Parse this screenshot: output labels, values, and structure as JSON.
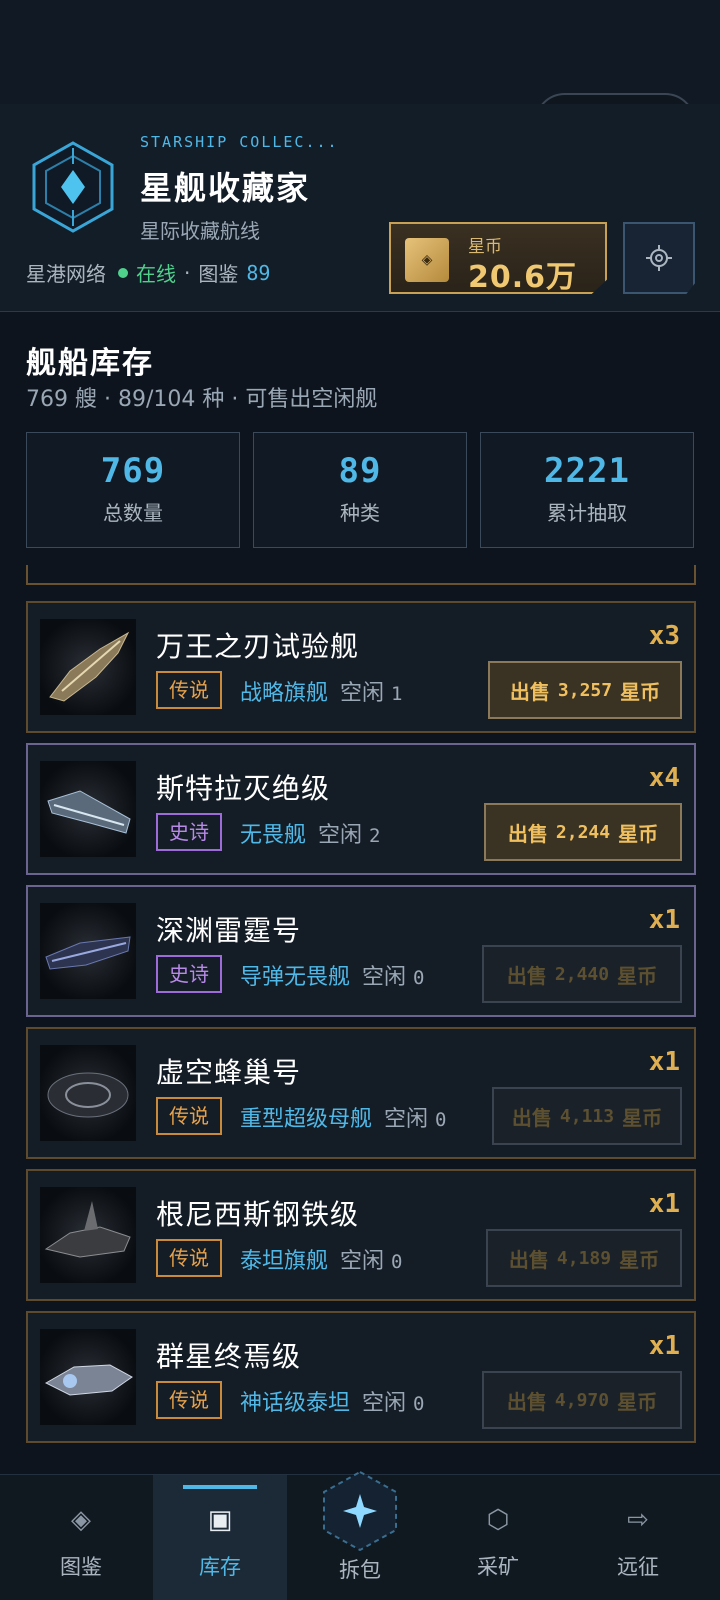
{
  "header": {
    "subtitle_en": "STARSHIP COLLEC...",
    "app_title": "星舰收藏家",
    "app_subtitle": "星际收藏航线",
    "network_label": "星港网络",
    "status_online": "在线",
    "separator": "·",
    "codex_label": "图鉴",
    "codex_count": "89",
    "currency_label": "星币",
    "currency_value": "20.6万",
    "capsule_dots": "•••"
  },
  "inventory": {
    "title": "舰船库存",
    "summary": "769 艘 · 89/104 种 · 可售出空闲舰",
    "stats": [
      {
        "value": "769",
        "label": "总数量"
      },
      {
        "value": "89",
        "label": "种类"
      },
      {
        "value": "2221",
        "label": "累计抽取"
      }
    ],
    "idle_label": "空闲",
    "sell_label": "出售",
    "coin_unit": "星币",
    "ships": [
      {
        "name": "万王之刃试验舰",
        "rarity": "传说",
        "class": "战略旗舰",
        "idle": "1",
        "qty": "x3",
        "price": "3,257",
        "sellable": true
      },
      {
        "name": "斯特拉灭绝级",
        "rarity": "史诗",
        "class": "无畏舰",
        "idle": "2",
        "qty": "x4",
        "price": "2,244",
        "sellable": true
      },
      {
        "name": "深渊雷霆号",
        "rarity": "史诗",
        "class": "导弹无畏舰",
        "idle": "0",
        "qty": "x1",
        "price": "2,440",
        "sellable": false
      },
      {
        "name": "虚空蜂巢号",
        "rarity": "传说",
        "class": "重型超级母舰",
        "idle": "0",
        "qty": "x1",
        "price": "4,113",
        "sellable": false
      },
      {
        "name": "根尼西斯钢铁级",
        "rarity": "传说",
        "class": "泰坦旗舰",
        "idle": "0",
        "qty": "x1",
        "price": "4,189",
        "sellable": false
      },
      {
        "name": "群星终焉级",
        "rarity": "传说",
        "class": "神话级泰坦",
        "idle": "0",
        "qty": "x1",
        "price": "4,970",
        "sellable": false
      }
    ]
  },
  "nav": {
    "items": [
      {
        "label": "图鉴",
        "icon": "codex-icon"
      },
      {
        "label": "库存",
        "icon": "inventory-icon"
      },
      {
        "label": "拆包",
        "icon": "unpack-icon"
      },
      {
        "label": "采矿",
        "icon": "mining-icon"
      },
      {
        "label": "远征",
        "icon": "expedition-icon"
      }
    ],
    "active": "库存"
  },
  "colors": {
    "accent": "#4fb8e6",
    "gold": "#f0c872",
    "online": "#4fd18b",
    "legendary": "#e6a24a",
    "epic": "#b88ae8"
  }
}
